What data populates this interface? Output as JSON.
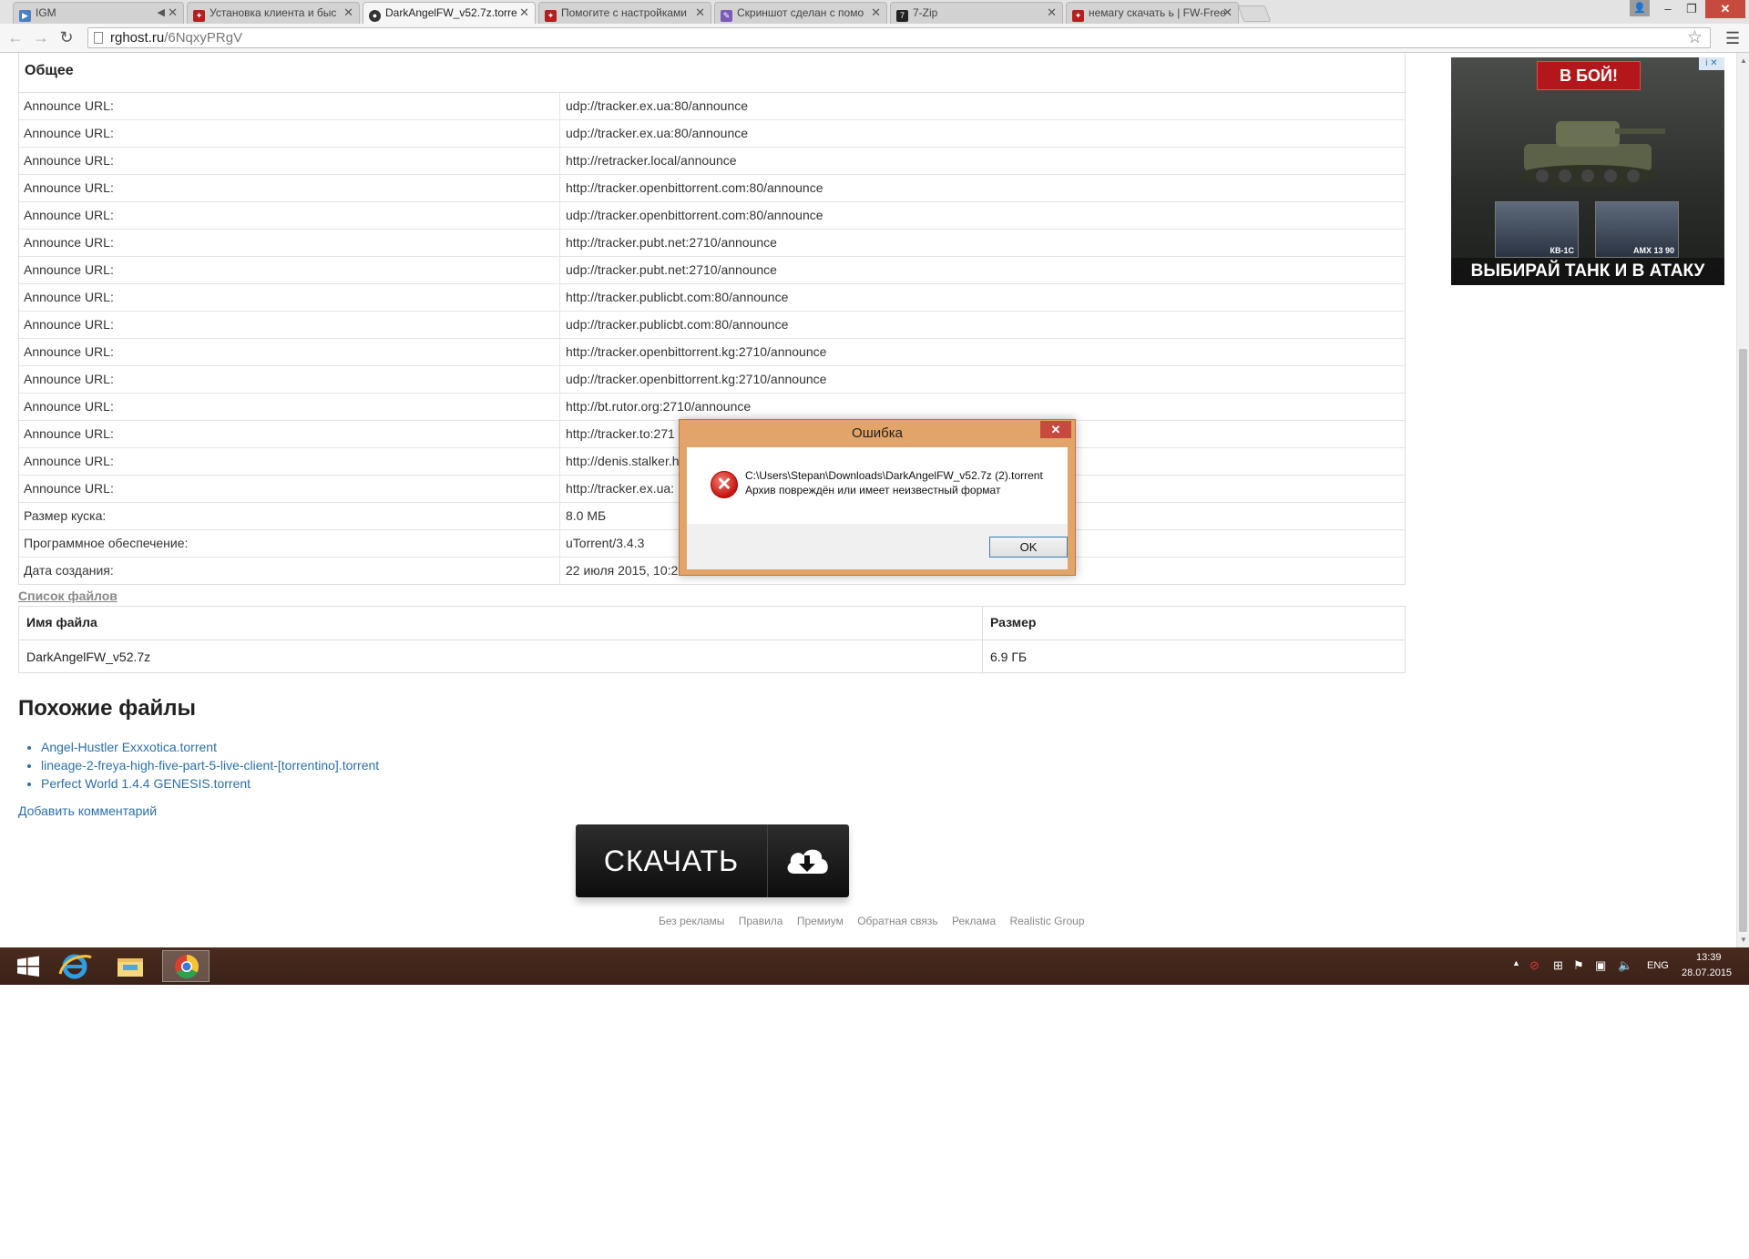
{
  "browser": {
    "tabs": [
      {
        "label": "IGM",
        "favicon": "play",
        "color": "#4a7fc1",
        "muted": true
      },
      {
        "label": "Установка клиента и быс",
        "favicon": "fw",
        "color": "#b32020"
      },
      {
        "label": "DarkAngelFW_v52.7z.torre",
        "favicon": "globe",
        "color": "#333333",
        "active": true
      },
      {
        "label": "Помогите с настройками",
        "favicon": "fw",
        "color": "#b32020"
      },
      {
        "label": "Скриншот сделан с помо",
        "favicon": "feather",
        "color": "#7b5bb8"
      },
      {
        "label": "7-Zip",
        "favicon": "7z",
        "color": "#222222"
      },
      {
        "label": "немагу скачать ь | FW-Free",
        "favicon": "fw",
        "color": "#b32020"
      }
    ],
    "url_host": "rghost.ru",
    "url_path": "/6NqxyPRgV"
  },
  "info": {
    "title": "Общее",
    "rows": [
      {
        "key": "Announce URL:",
        "value": "udp://tracker.ex.ua:80/announce"
      },
      {
        "key": "Announce URL:",
        "value": "udp://tracker.ex.ua:80/announce"
      },
      {
        "key": "Announce URL:",
        "value": "http://retracker.local/announce"
      },
      {
        "key": "Announce URL:",
        "value": "http://tracker.openbittorrent.com:80/announce"
      },
      {
        "key": "Announce URL:",
        "value": "udp://tracker.openbittorrent.com:80/announce"
      },
      {
        "key": "Announce URL:",
        "value": "http://tracker.pubt.net:2710/announce"
      },
      {
        "key": "Announce URL:",
        "value": "udp://tracker.pubt.net:2710/announce"
      },
      {
        "key": "Announce URL:",
        "value": "http://tracker.publicbt.com:80/announce"
      },
      {
        "key": "Announce URL:",
        "value": "udp://tracker.publicbt.com:80/announce"
      },
      {
        "key": "Announce URL:",
        "value": "http://tracker.openbittorrent.kg:2710/announce"
      },
      {
        "key": "Announce URL:",
        "value": "udp://tracker.openbittorrent.kg:2710/announce"
      },
      {
        "key": "Announce URL:",
        "value": "http://bt.rutor.org:2710/announce"
      },
      {
        "key": "Announce URL:",
        "value": "http://tracker.to:271"
      },
      {
        "key": "Announce URL:",
        "value": "http://denis.stalker.h"
      },
      {
        "key": "Announce URL:",
        "value": "http://tracker.ex.ua:"
      },
      {
        "key": "Размер куска:",
        "value": "8.0 МБ"
      },
      {
        "key": "Программное обеспечение:",
        "value": "uTorrent/3.4.3"
      },
      {
        "key": "Дата создания:",
        "value": "22 июля 2015, 10:2"
      }
    ]
  },
  "files": {
    "title": "Список файлов",
    "col_name": "Имя файла",
    "col_size": "Размер",
    "rows": [
      {
        "name": "DarkAngelFW_v52.7z",
        "size": "6.9 ГБ"
      }
    ]
  },
  "similar": {
    "title": "Похожие файлы",
    "items": [
      "Angel-Hustler Exxxotica.torrent",
      "lineage-2-freya-high-five-part-5-live-client-[torrentino].torrent",
      "Perfect World 1.4.4 GENESIS.torrent"
    ]
  },
  "add_comment": "Добавить комментарий",
  "download_label": "СКАЧАТЬ",
  "footer": [
    "Без рекламы",
    "Правила",
    "Премиум",
    "Обратная связь",
    "Реклама",
    "Realistic Group"
  ],
  "ad": {
    "top_label": "В БОЙ!",
    "bottom_label": "ВЫБИРАЙ ТАНК И В АТАКУ",
    "card1": "КВ-1С",
    "card2": "AMX 13 90"
  },
  "dialog": {
    "title": "Ошибка",
    "path": "C:\\Users\\Stepan\\Downloads\\DarkAngelFW_v52.7z (2).torrent",
    "message": "Архив повреждён или имеет неизвестный формат",
    "ok": "OK"
  },
  "taskbar": {
    "lang": "ENG",
    "time": "13:39",
    "date": "28.07.2015"
  }
}
